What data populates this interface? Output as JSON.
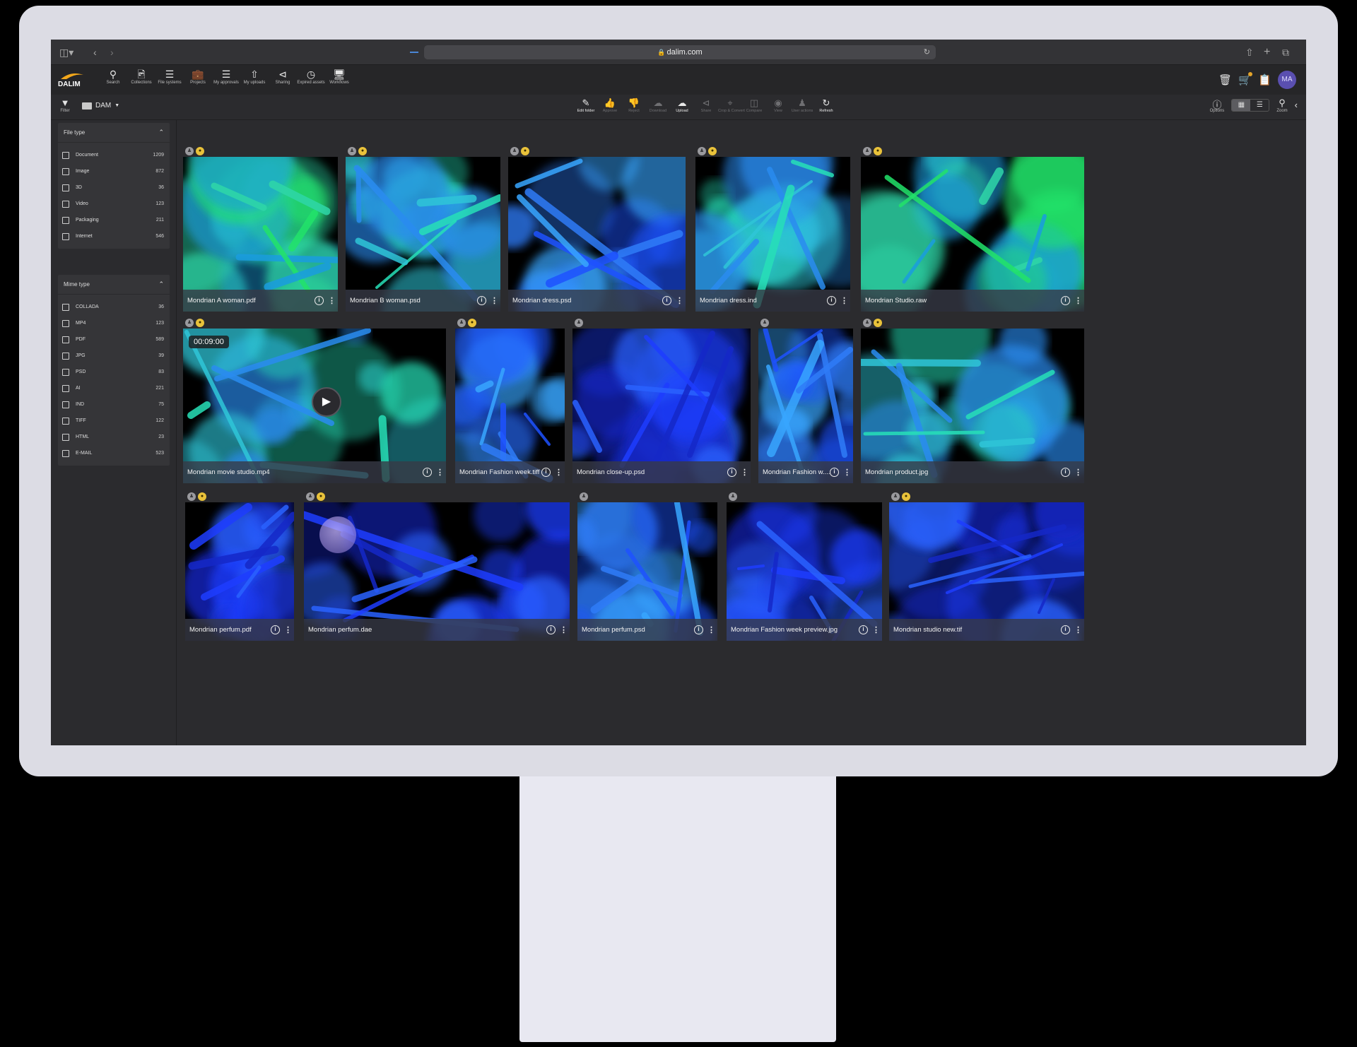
{
  "browser": {
    "url": "dalim.com",
    "reload_icon": "reload-icon",
    "left_icons": [
      "sidebar-icon",
      "back-icon",
      "forward-icon"
    ],
    "right_icons": [
      "share-icon",
      "plus-icon",
      "tabs-icon"
    ]
  },
  "app": {
    "logo_text": "DALIM",
    "nav": [
      {
        "label": "Search",
        "icon": "search-icon"
      },
      {
        "label": "Collections",
        "icon": "collections-icon"
      },
      {
        "label": "File systems",
        "icon": "database-icon"
      },
      {
        "label": "Projects",
        "icon": "briefcase-icon"
      },
      {
        "label": "My approvals",
        "icon": "list-check-icon"
      },
      {
        "label": "My uploads",
        "icon": "upload-icon"
      },
      {
        "label": "Sharing",
        "icon": "share-icon"
      },
      {
        "label": "Expired assets",
        "icon": "clock-icon"
      },
      {
        "label": "Workflows",
        "icon": "monitor-icon"
      }
    ],
    "avatar_initials": "MA",
    "header_icons": [
      "trash-icon",
      "cart-icon",
      "clipboard-icon"
    ]
  },
  "toolbar": {
    "filter_label": "Filter",
    "folder_label": "DAM",
    "tools": [
      {
        "label": "Edit folder",
        "icon": "pencil-icon",
        "enabled": true
      },
      {
        "label": "Approve",
        "icon": "thumbs-up-icon",
        "enabled": false
      },
      {
        "label": "Reject",
        "icon": "thumbs-down-icon",
        "enabled": false
      },
      {
        "label": "Download",
        "icon": "cloud-download-icon",
        "enabled": false
      },
      {
        "label": "Upload",
        "icon": "cloud-upload-icon",
        "enabled": true
      },
      {
        "label": "Share",
        "icon": "share-icon",
        "enabled": false
      },
      {
        "label": "Crop & Convert",
        "icon": "crop-icon",
        "enabled": false
      },
      {
        "label": "Compare",
        "icon": "compare-icon",
        "enabled": false
      },
      {
        "label": "View",
        "icon": "eye-icon",
        "enabled": false
      },
      {
        "label": "User actions",
        "icon": "user-actions-icon",
        "enabled": false
      },
      {
        "label": "Refresh",
        "icon": "refresh-icon",
        "enabled": true
      }
    ],
    "options_label": "Options",
    "zoom_label": "Zoom"
  },
  "facets": [
    {
      "title": "File type",
      "items": [
        {
          "name": "Document",
          "count": "1209"
        },
        {
          "name": "Image",
          "count": "872"
        },
        {
          "name": "3D",
          "count": "36"
        },
        {
          "name": "Video",
          "count": "123"
        },
        {
          "name": "Packaging",
          "count": "211"
        },
        {
          "name": "Internet",
          "count": "546"
        }
      ]
    },
    {
      "title": "Mime type",
      "items": [
        {
          "name": "COLLADA",
          "count": "36"
        },
        {
          "name": "MP4",
          "count": "123"
        },
        {
          "name": "PDF",
          "count": "589"
        },
        {
          "name": "JPG",
          "count": "39"
        },
        {
          "name": "PSD",
          "count": "83"
        },
        {
          "name": "AI",
          "count": "221"
        },
        {
          "name": "IND",
          "count": "75"
        },
        {
          "name": "TIFF",
          "count": "122"
        },
        {
          "name": "HTML",
          "count": "23"
        },
        {
          "name": "E-MAIL",
          "count": "523"
        }
      ]
    }
  ],
  "assets": [
    {
      "name": "Mondrian A woman.pdf",
      "badges": [
        "grey",
        "gold"
      ],
      "art": "green"
    },
    {
      "name": "Mondrian B woman.psd",
      "badges": [
        "grey",
        "gold"
      ],
      "art": "cyan"
    },
    {
      "name": "Mondrian dress.psd",
      "badges": [
        "grey",
        "gold"
      ],
      "art": "blue"
    },
    {
      "name": "Mondrian dress.ind",
      "badges": [
        "grey",
        "gold"
      ],
      "art": "cyan"
    },
    {
      "name": "Mondrian Studio.raw",
      "badges": [
        "grey",
        "gold"
      ],
      "art": "green"
    },
    {
      "name": "Mondrian movie studio.mp4",
      "badges": [
        "grey",
        "gold"
      ],
      "art": "cyan",
      "duration": "00:09:00"
    },
    {
      "name": "Mondrian Fashion week.tiff",
      "badges": [
        "grey",
        "gold"
      ],
      "art": "blue"
    },
    {
      "name": "Mondrian close-up.psd",
      "badges": [
        "grey"
      ],
      "art": "deep"
    },
    {
      "name": "Mondrian Fashion w.....jpg",
      "badges": [
        "grey"
      ],
      "art": "blue"
    },
    {
      "name": "Mondrian product.jpg",
      "badges": [
        "grey",
        "gold"
      ],
      "art": "cyan"
    },
    {
      "name": "Mondrian perfum.pdf",
      "badges": [
        "grey",
        "gold"
      ],
      "art": "deep"
    },
    {
      "name": "Mondrian perfum.dae",
      "badges": [
        "grey",
        "gold"
      ],
      "art": "deep"
    },
    {
      "name": "Mondrian perfum.psd",
      "badges": [
        "grey"
      ],
      "art": "blue"
    },
    {
      "name": "Mondrian Fashion week preview.jpg",
      "badges": [
        "grey"
      ],
      "art": "deep"
    },
    {
      "name": "Mondrian studio new.tif",
      "badges": [
        "grey",
        "gold"
      ],
      "art": "deep"
    }
  ],
  "colors": {
    "accent_green": "#2be36a",
    "accent_cyan": "#2fb9d8",
    "accent_blue": "#1f55ff",
    "badge_gold": "#e9c23a"
  }
}
